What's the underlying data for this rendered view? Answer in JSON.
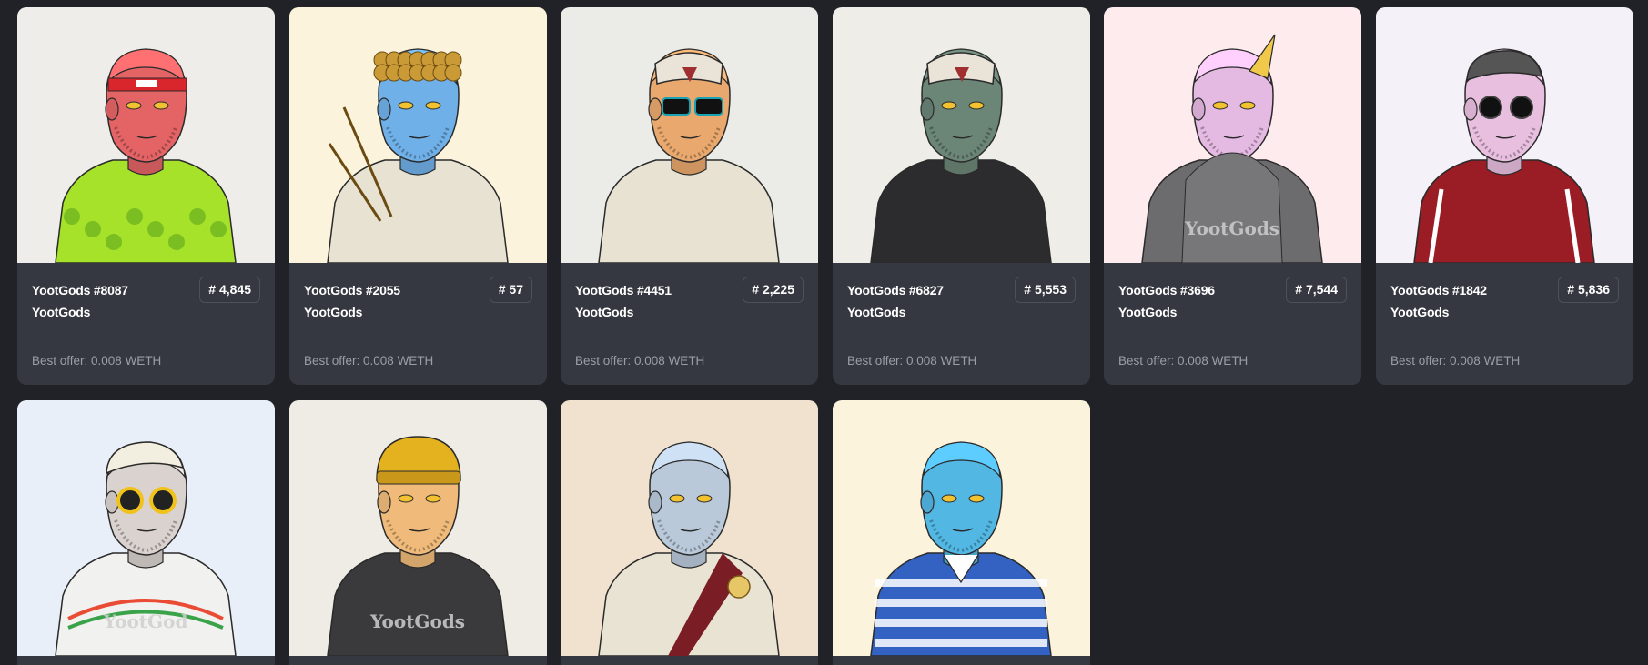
{
  "offer_prefix": "Best offer:",
  "cards": [
    {
      "name": "YootGods #8087",
      "collection": "YootGods",
      "rank": "# 4,845",
      "offer": "Best offer: 0.008 WETH",
      "bg": "#efedea",
      "skin": "#e46466",
      "shirt": "#a6e22a",
      "accessory": "bandana"
    },
    {
      "name": "YootGods #2055",
      "collection": "YootGods",
      "rank": "# 57",
      "offer": "Best offer: 0.008 WETH",
      "bg": "#fbf3dc",
      "skin": "#6fb0e8",
      "shirt": "#e7e2d2",
      "accessory": "curly-hair"
    },
    {
      "name": "YootGods #4451",
      "collection": "YootGods",
      "rank": "# 2,225",
      "offer": "Best offer: 0.008 WETH",
      "bg": "#ebebe7",
      "skin": "#e9a86d",
      "shirt": "#e7e2d2",
      "accessory": "mask-sunglasses"
    },
    {
      "name": "YootGods #6827",
      "collection": "YootGods",
      "rank": "# 5,553",
      "offer": "Best offer: 0.008 WETH",
      "bg": "#efede8",
      "skin": "#6b8576",
      "shirt": "#2c2c2e",
      "accessory": "mask"
    },
    {
      "name": "YootGods #3696",
      "collection": "YootGods",
      "rank": "# 7,544",
      "offer": "Best offer: 0.008 WETH",
      "bg": "#fdebee",
      "skin": "#e4b9e2",
      "shirt": "#6c6c6e",
      "accessory": "unicorn-horn",
      "shirt_text": "YootGods"
    },
    {
      "name": "YootGods #1842",
      "collection": "YootGods",
      "rank": "# 5,836",
      "offer": "Best offer: 0.008 WETH",
      "bg": "#f4f1f8",
      "skin": "#e9bfe0",
      "shirt": "#9a1c24",
      "accessory": "cap-round-glasses"
    },
    {
      "name": "",
      "collection": "",
      "rank": "",
      "offer": "",
      "bg": "#e8eff8",
      "skin": "#d9d2ce",
      "shirt": "#f1f1ef",
      "accessory": "cap-yellow-glasses",
      "shirt_text": "YootGod"
    },
    {
      "name": "",
      "collection": "",
      "rank": "",
      "offer": "",
      "bg": "#efece6",
      "skin": "#f0bb7a",
      "shirt": "#3a3a3c",
      "accessory": "beanie",
      "shirt_text": "YootGods"
    },
    {
      "name": "",
      "collection": "",
      "rank": "",
      "offer": "",
      "bg": "#f1e2cf",
      "skin": "#b9c9da",
      "shirt": "#e9e3d3",
      "accessory": "toga"
    },
    {
      "name": "",
      "collection": "",
      "rank": "",
      "offer": "",
      "bg": "#fbf3dc",
      "skin": "#53b7e4",
      "shirt": "#3362c2",
      "accessory": "polo-stripes"
    }
  ]
}
